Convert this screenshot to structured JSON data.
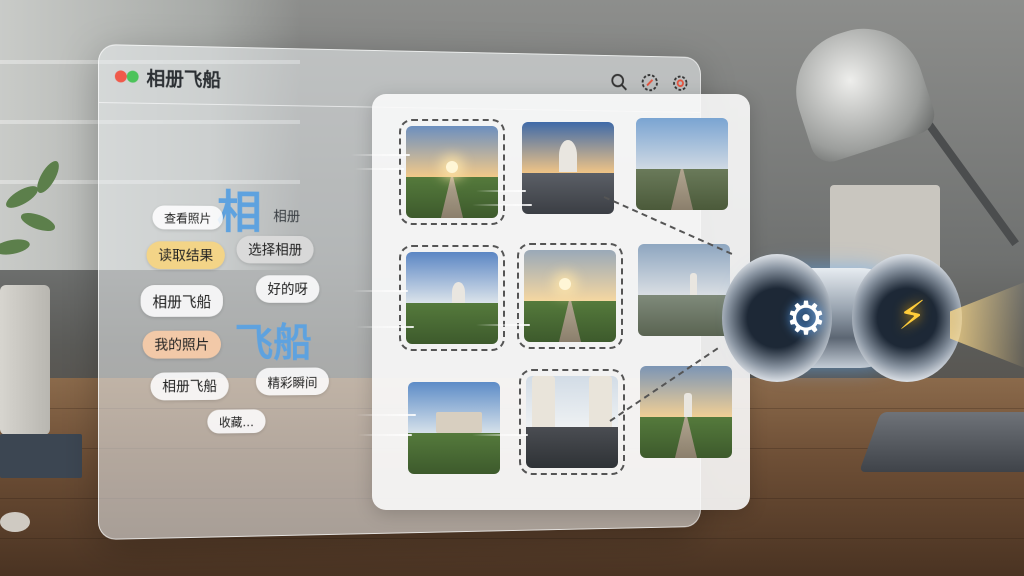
{
  "app": {
    "title": "相册飞船"
  },
  "toolbar": [
    {
      "name": "search-icon"
    },
    {
      "name": "compass-icon"
    },
    {
      "name": "settings-icon"
    }
  ],
  "hero": {
    "big_top": "相",
    "small_top": "相册",
    "big_bottom": "飞船"
  },
  "tags": [
    {
      "label": "查看照片",
      "style": "white"
    },
    {
      "label": "读取结果",
      "style": "yellow"
    },
    {
      "label": "选择相册",
      "style": "grey"
    },
    {
      "label": "相册飞船",
      "style": "white"
    },
    {
      "label": "好的呀",
      "style": "white"
    },
    {
      "label": "我的照片",
      "style": "orange"
    },
    {
      "label": "相册飞船",
      "style": "white"
    },
    {
      "label": "精彩瞬间",
      "style": "white"
    },
    {
      "label": "收藏…",
      "style": "white"
    }
  ],
  "gallery": {
    "thumbnails": [
      {
        "scene": "sunset-path",
        "selected": true
      },
      {
        "scene": "observatory",
        "selected": false
      },
      {
        "scene": "coast-road",
        "selected": false
      },
      {
        "scene": "observatory-field",
        "selected": true
      },
      {
        "scene": "sunset-walkway",
        "selected": true
      },
      {
        "scene": "coast-town",
        "selected": false
      },
      {
        "scene": "terrace-view",
        "selected": false
      },
      {
        "scene": "courtyard-street",
        "selected": true
      },
      {
        "scene": "tower-path",
        "selected": false
      }
    ]
  },
  "capsule": {
    "left_icon": "gear-icon",
    "right_icon": "lightning-icon"
  },
  "colors": {
    "accent_blue": "#5ea2df",
    "traffic_red": "#f05a4a",
    "traffic_green": "#4cc35a",
    "bolt_yellow": "#ffcc3a"
  }
}
